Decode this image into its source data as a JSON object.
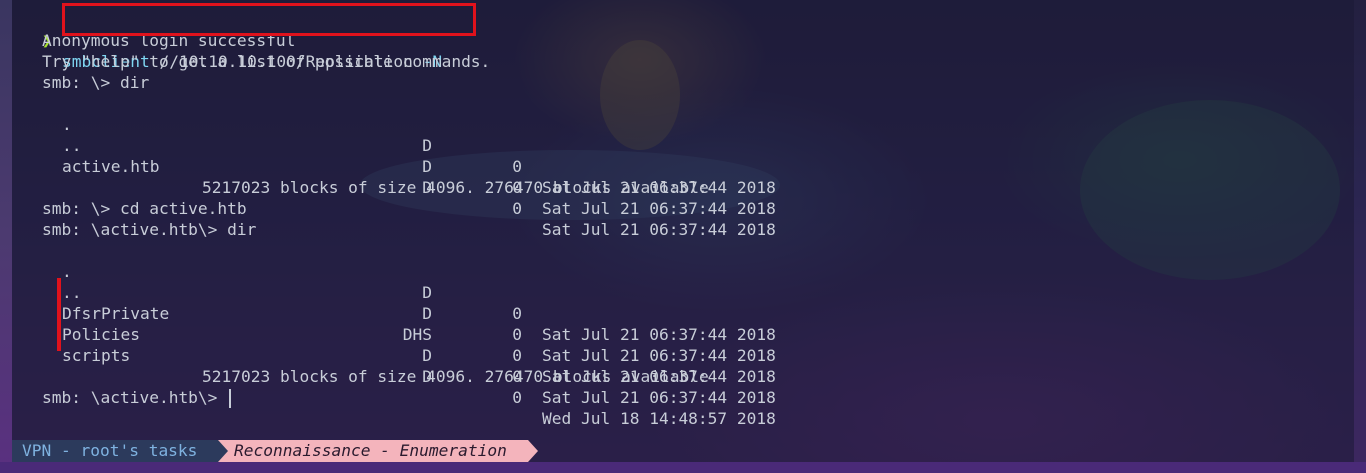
{
  "terminal": {
    "prompt_symbol": "❯",
    "command": {
      "program": "smbclient",
      "share": " //10.10.10.100/Replication ",
      "flag": "-N"
    },
    "line_anon": "Anonymous login successful",
    "line_help": "Try \"help\" to get a list of possible commands.",
    "prompt1": "smb: \\> dir",
    "listing1": [
      {
        "name": ".",
        "attr": "D",
        "size": "0",
        "date": "Sat Jul 21 06:37:44 2018"
      },
      {
        "name": "..",
        "attr": "D",
        "size": "0",
        "date": "Sat Jul 21 06:37:44 2018"
      },
      {
        "name": "active.htb",
        "attr": "D",
        "size": "0",
        "date": "Sat Jul 21 06:37:44 2018"
      }
    ],
    "blocks1": "5217023 blocks of size 4096. 276470 blocks available",
    "prompt2": "smb: \\> cd active.htb",
    "prompt3": "smb: \\active.htb\\> dir",
    "listing2": [
      {
        "name": ".",
        "attr": "D",
        "size": "0",
        "date": "Sat Jul 21 06:37:44 2018"
      },
      {
        "name": "..",
        "attr": "D",
        "size": "0",
        "date": "Sat Jul 21 06:37:44 2018"
      },
      {
        "name": "DfsrPrivate",
        "attr": "DHS",
        "size": "0",
        "date": "Sat Jul 21 06:37:44 2018"
      },
      {
        "name": "Policies",
        "attr": "D",
        "size": "0",
        "date": "Sat Jul 21 06:37:44 2018"
      },
      {
        "name": "scripts",
        "attr": "D",
        "size": "0",
        "date": "Wed Jul 18 14:48:57 2018"
      }
    ],
    "blocks2": "5217023 blocks of size 4096. 276470 blocks available",
    "prompt4": "smb: \\active.htb\\> "
  },
  "statusbar": {
    "segment1": "VPN - root's tasks",
    "segment2": "Reconnaissance - Enumeration"
  },
  "colors": {
    "highlight": "#e0121c",
    "command": "#7fd6f2",
    "prompt_arrow": "#a6e22e",
    "status_seg2_bg": "#f4b4bc"
  }
}
